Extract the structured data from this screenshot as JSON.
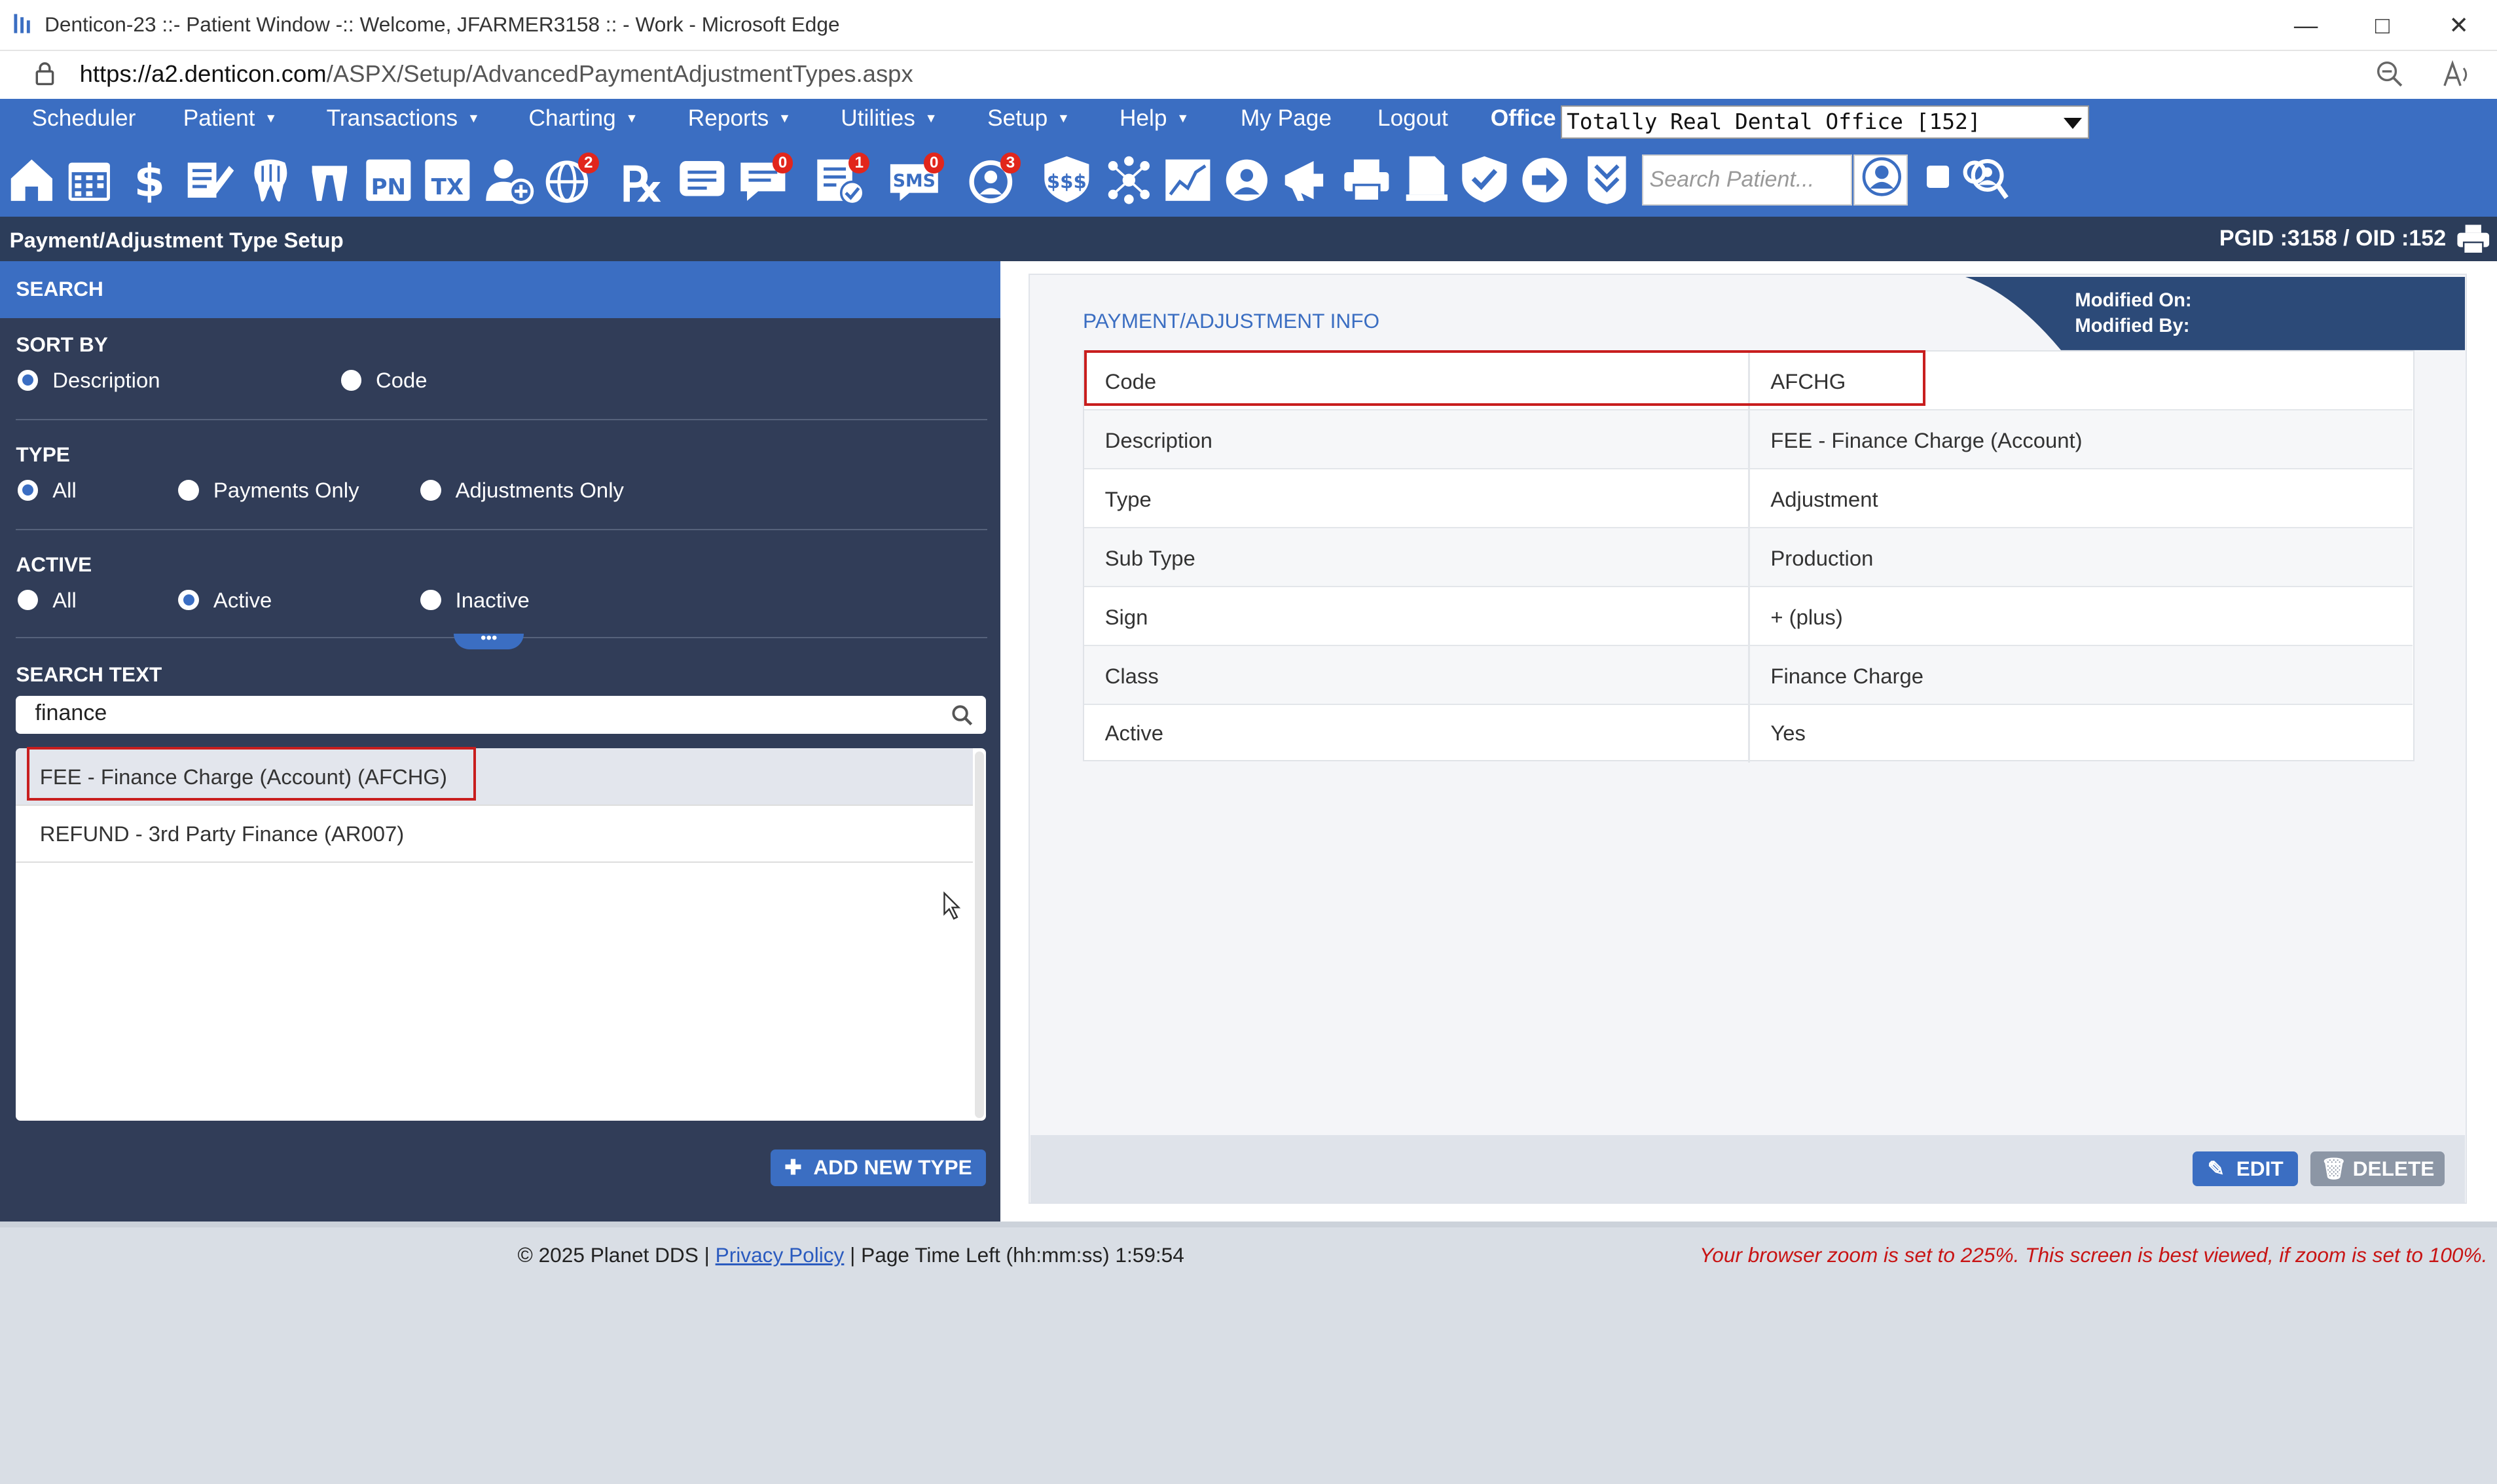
{
  "window": {
    "title": "Denticon-23 ::- Patient Window -:: Welcome, JFARMER3158 :: - Work - Microsoft Edge",
    "url_domain": "https://a2.denticon.com",
    "url_path": "/ASPX/Setup/AdvancedPaymentAdjustmentTypes.aspx"
  },
  "menu": {
    "items": [
      {
        "label": "Scheduler"
      },
      {
        "label": "Patient"
      },
      {
        "label": "Transactions"
      },
      {
        "label": "Charting"
      },
      {
        "label": "Reports"
      },
      {
        "label": "Utilities"
      },
      {
        "label": "Setup"
      },
      {
        "label": "Help"
      },
      {
        "label": "My Page"
      },
      {
        "label": "Logout"
      }
    ],
    "office_label": "Office",
    "office_value": "Totally Real Dental Office [152]"
  },
  "toolbar": {
    "badges": {
      "web": "2",
      "messages": "0",
      "tasks": "1",
      "sms": "0",
      "recall": "3"
    },
    "search_placeholder": "Search Patient..."
  },
  "header": {
    "page_title": "Payment/Adjustment Type Setup",
    "ids": "PGID :3158  /  OID :152"
  },
  "search": {
    "panel_title": "SEARCH",
    "sort_by": {
      "label": "SORT BY",
      "options": [
        "Description",
        "Code"
      ],
      "selected": "Description"
    },
    "type": {
      "label": "TYPE",
      "options": [
        "All",
        "Payments Only",
        "Adjustments Only"
      ],
      "selected": "All"
    },
    "active": {
      "label": "ACTIVE",
      "options": [
        "All",
        "Active",
        "Inactive"
      ],
      "selected": "Active"
    },
    "search_text_label": "SEARCH TEXT",
    "search_text_value": "finance",
    "results": [
      "FEE - Finance Charge (Account) (AFCHG)",
      "REFUND - 3rd Party Finance (AR007)"
    ],
    "add_button": "ADD NEW TYPE"
  },
  "info": {
    "title": "PAYMENT/ADJUSTMENT INFO",
    "modified_on_label": "Modified On:",
    "modified_by_label": "Modified By:",
    "rows": [
      {
        "key": "Code",
        "value": "AFCHG"
      },
      {
        "key": "Description",
        "value": "FEE - Finance Charge (Account)"
      },
      {
        "key": "Type",
        "value": "Adjustment"
      },
      {
        "key": "Sub Type",
        "value": "Production"
      },
      {
        "key": "Sign",
        "value": "+ (plus)"
      },
      {
        "key": "Class",
        "value": "Finance Charge"
      },
      {
        "key": "Active",
        "value": "Yes"
      }
    ],
    "edit_button": "EDIT",
    "delete_button": "DELETE"
  },
  "footer": {
    "copyright": "© 2025 Planet DDS |",
    "privacy_link": "Privacy Policy",
    "time_left": "| Page Time Left (hh:mm:ss) 1:59:54",
    "zoom_warning": "Your browser zoom is set to 225%. This screen is best viewed, if zoom is set to 100%."
  },
  "colors": {
    "primary": "#3b6ec2",
    "panel_dark": "#313d58",
    "highlight_red": "#c81e1e",
    "delete_gray": "#8c96a5"
  }
}
